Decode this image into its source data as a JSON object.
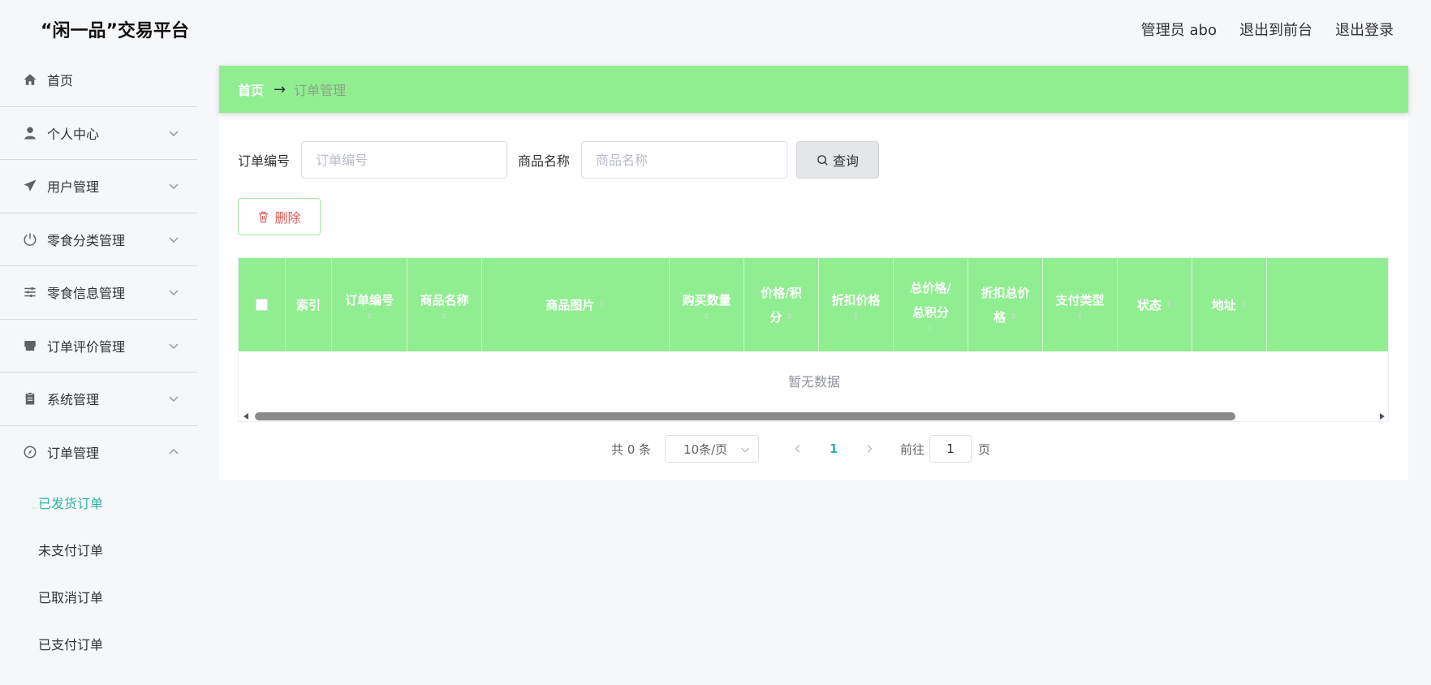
{
  "header": {
    "brand": "“闲一品”交易平台",
    "user": "管理员 abo",
    "to_frontend": "退出到前台",
    "logout": "退出登录"
  },
  "sidebar": {
    "items": [
      {
        "label": "首页",
        "icon": "home-icon"
      },
      {
        "label": "个人中心",
        "icon": "user-icon"
      },
      {
        "label": "用户管理",
        "icon": "paper-plane-icon"
      },
      {
        "label": "零食分类管理",
        "icon": "power-icon"
      },
      {
        "label": "零食信息管理",
        "icon": "sliders-icon"
      },
      {
        "label": "订单评价管理",
        "icon": "shop-icon"
      },
      {
        "label": "系统管理",
        "icon": "clipboard-icon"
      },
      {
        "label": "订单管理",
        "icon": "compass-icon"
      }
    ],
    "sub_items": [
      {
        "label": "已发货订单",
        "active": true
      },
      {
        "label": "未支付订单",
        "active": false
      },
      {
        "label": "已取消订单",
        "active": false
      },
      {
        "label": "已支付订单",
        "active": false
      }
    ]
  },
  "breadcrumb": {
    "home": "首页",
    "arrow": "→",
    "current": "订单管理"
  },
  "search": {
    "order_no_label": "订单编号",
    "order_no_placeholder": "订单编号",
    "goods_name_label": "商品名称",
    "goods_name_placeholder": "商品名称",
    "query_label": "查询"
  },
  "actions": {
    "delete_label": "删除"
  },
  "table": {
    "columns": [
      {
        "line1": "索引",
        "line2": "",
        "sortable": false
      },
      {
        "line1": "订单编号",
        "line2": "",
        "sortable": true
      },
      {
        "line1": "商品名称",
        "line2": "",
        "sortable": true
      },
      {
        "line1": "商品图片",
        "line2": "",
        "sortable": true
      },
      {
        "line1": "购买数量",
        "line2": "",
        "sortable": true
      },
      {
        "line1": "价格/积",
        "line2": "分",
        "sortable": true
      },
      {
        "line1": "折扣价格",
        "line2": "",
        "sortable": true
      },
      {
        "line1": "总价格/",
        "line2": "总积分",
        "sortable": true
      },
      {
        "line1": "折扣总价",
        "line2": "格",
        "sortable": true
      },
      {
        "line1": "支付类型",
        "line2": "",
        "sortable": true
      },
      {
        "line1": "状态",
        "line2": "",
        "sortable": true
      },
      {
        "line1": "地址",
        "line2": "",
        "sortable": true
      }
    ],
    "empty_text": "暂无数据"
  },
  "pagination": {
    "total": "共 0 条",
    "page_size": "10条/页",
    "current_page": "1",
    "goto_prefix": "前往",
    "goto_value": "1",
    "goto_suffix": "页"
  },
  "colors": {
    "accent_green": "#90ee90",
    "active_teal": "#2fb6a0",
    "delete_red": "#e05b5b"
  }
}
